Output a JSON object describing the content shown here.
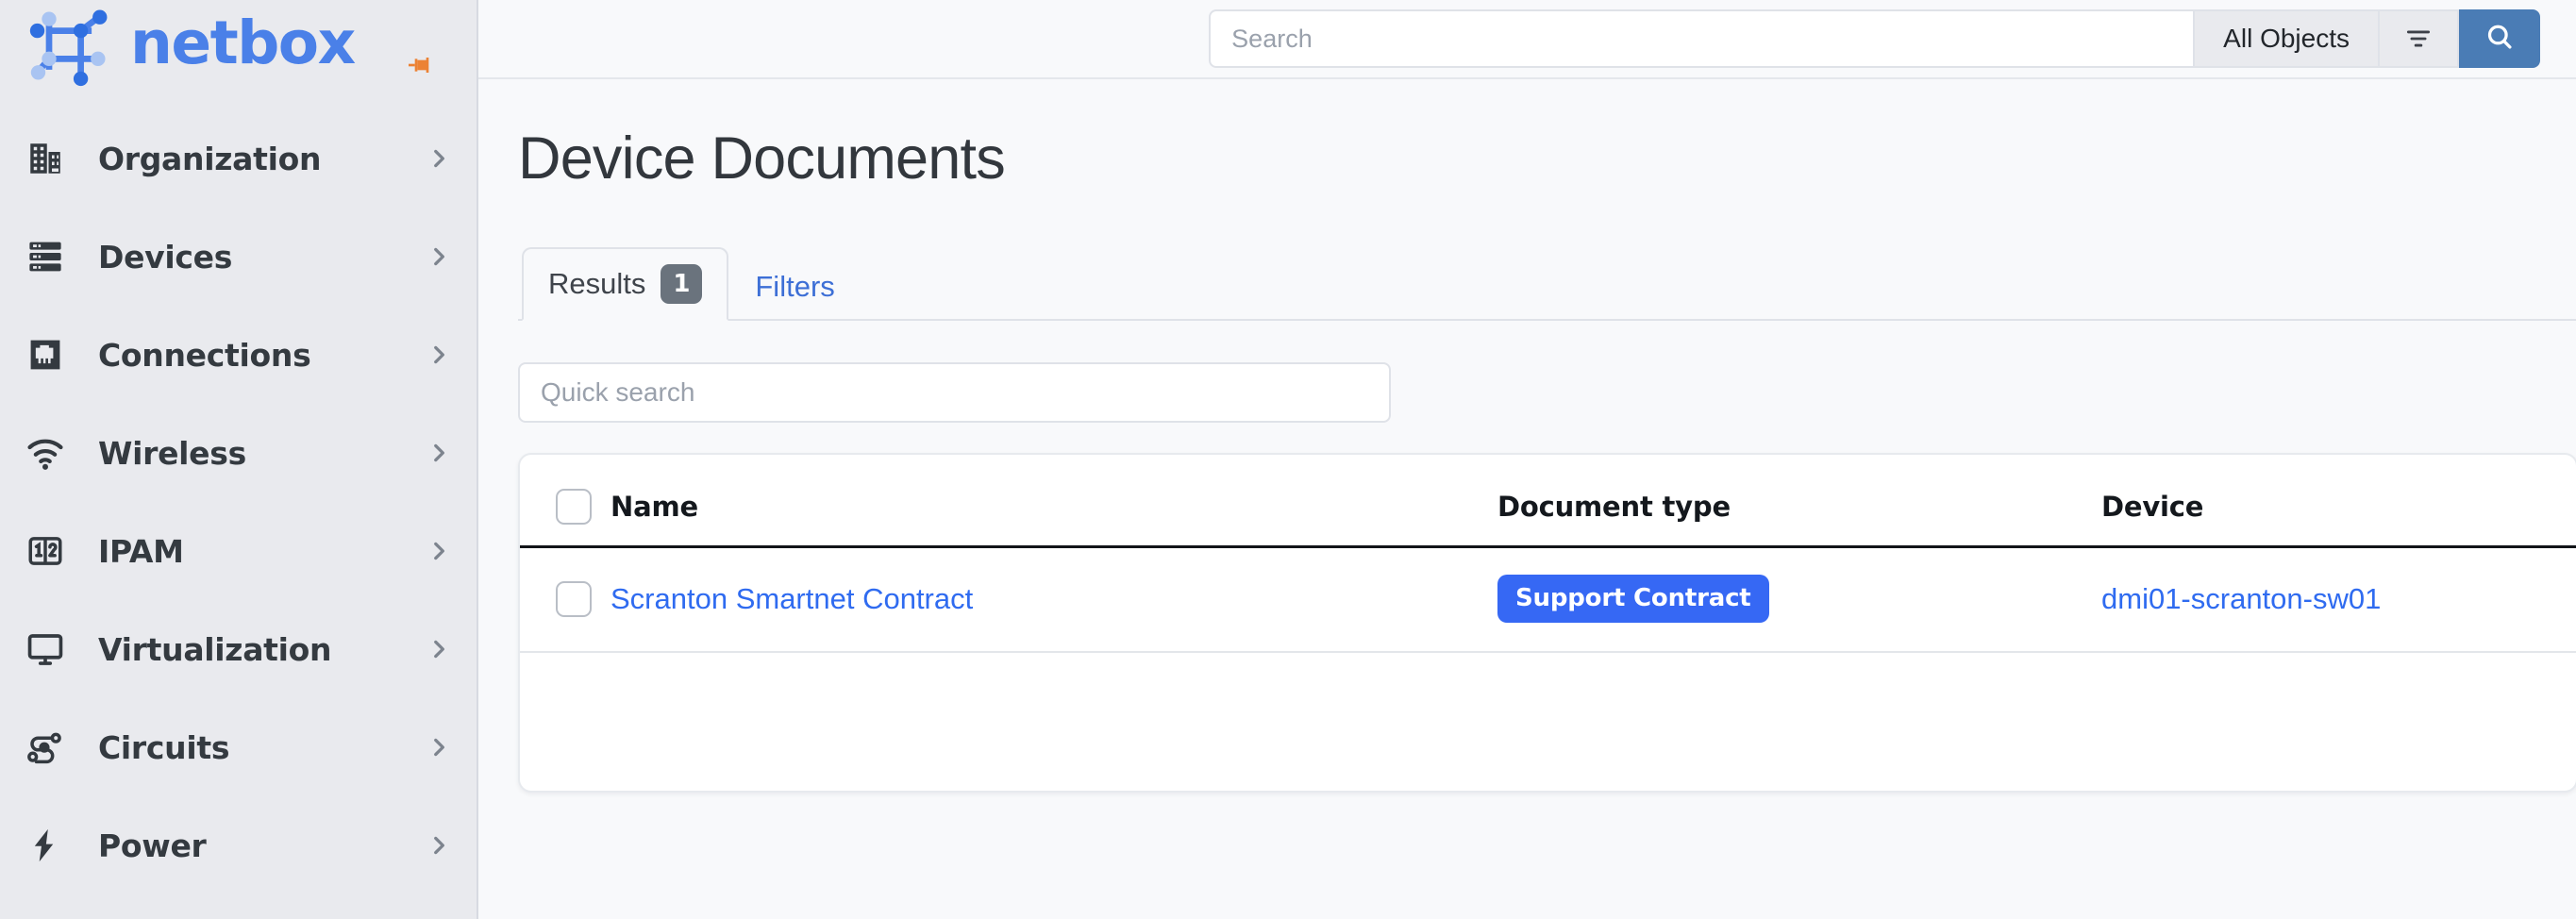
{
  "brand": {
    "word": "netbox",
    "logo_icon": "netbox-logo-icon",
    "pin_icon": "pin-icon",
    "accent": "#4a80e8",
    "pin_color": "#ec8234"
  },
  "sidebar": {
    "items": [
      {
        "label": "Organization",
        "icon": "building-icon",
        "chevron": "chevron-right-icon"
      },
      {
        "label": "Devices",
        "icon": "server-rack-icon",
        "chevron": "chevron-right-icon"
      },
      {
        "label": "Connections",
        "icon": "rj45-jack-icon",
        "chevron": "chevron-right-icon"
      },
      {
        "label": "Wireless",
        "icon": "wifi-icon",
        "chevron": "chevron-right-icon"
      },
      {
        "label": "IPAM",
        "icon": "numbers-box-icon",
        "chevron": "chevron-right-icon"
      },
      {
        "label": "Virtualization",
        "icon": "monitor-icon",
        "chevron": "chevron-right-icon"
      },
      {
        "label": "Circuits",
        "icon": "circuit-path-icon",
        "chevron": "chevron-right-icon"
      },
      {
        "label": "Power",
        "icon": "lightning-bolt-icon",
        "chevron": "chevron-right-icon"
      }
    ]
  },
  "topbar": {
    "search": {
      "value": "",
      "placeholder": "Search",
      "icon": "search-icon"
    },
    "scope_label": "All Objects",
    "filter_icon": "filter-icon",
    "submit_icon": "search-icon",
    "submit_color": "#4a7cb5"
  },
  "page": {
    "title": "Device Documents"
  },
  "tabs": [
    {
      "label": "Results",
      "badge": "1",
      "active": true
    },
    {
      "label": "Filters",
      "badge": "",
      "active": false
    }
  ],
  "quick_search": {
    "value": "",
    "placeholder": "Quick search"
  },
  "table": {
    "columns": [
      "Name",
      "Document type",
      "Device"
    ],
    "select_all_checkbox": "unchecked",
    "rows": [
      {
        "checkbox": "unchecked",
        "name": "Scranton Smartnet Contract",
        "document_type": "Support Contract",
        "document_type_color": "#3668f4",
        "device": "dmi01-scranton-sw01"
      }
    ]
  }
}
